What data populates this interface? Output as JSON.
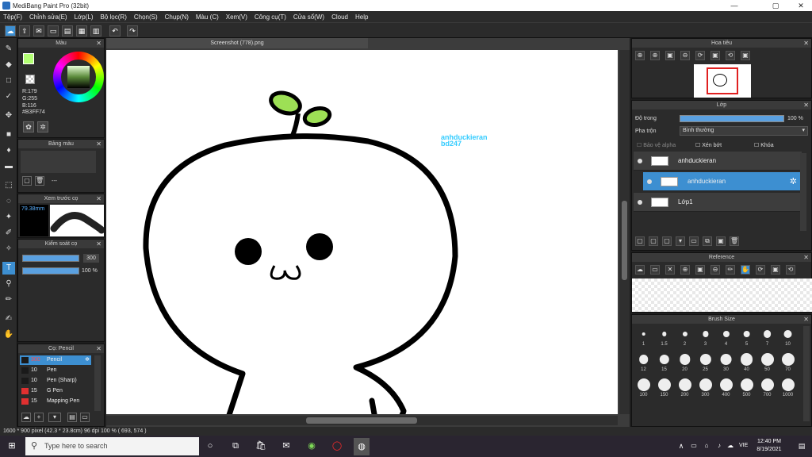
{
  "window": {
    "title": "MediBang Paint Pro (32bit)",
    "min": "—",
    "max": "▢",
    "close": "✕"
  },
  "menu": [
    "Tệp(F)",
    "Chỉnh sửa(E)",
    "Lớp(L)",
    "Bộ lọc(R)",
    "Chọn(S)",
    "Chụp(N)",
    "Màu (C)",
    "Xem(V)",
    "Công cụ(T)",
    "Cửa sổ(W)",
    "Cloud",
    "Help"
  ],
  "toolbar": {
    "undo": "↶",
    "redo": "↷"
  },
  "color_panel": {
    "title": "Màu",
    "rgb": "R:179\nG:255\nB:116",
    "hex": "#B3FF74"
  },
  "palette_panel": {
    "title": "Bảng màu",
    "dash": "---"
  },
  "brush_preview": {
    "title": "Xem trước cọ",
    "size": "79.38mm"
  },
  "brush_control": {
    "title": "Kiểm soát cọ",
    "size": "300",
    "opacity": "100 %",
    "size_level": 1.0,
    "opacity_level": 1.0
  },
  "brush_list": {
    "title": "Cọ: Pencil",
    "items": [
      {
        "size": "300",
        "name": "Pencil",
        "color": "#1a1a1a"
      },
      {
        "size": "10",
        "name": "Pen",
        "color": "#1a1a1a"
      },
      {
        "size": "10",
        "name": "Pen (Sharp)",
        "color": "#1a1a1a"
      },
      {
        "size": "15",
        "name": "G Pen",
        "color": "#e03030"
      },
      {
        "size": "15",
        "name": "Mapping Pen",
        "color": "#e03030"
      }
    ]
  },
  "document": {
    "tab": "Screenshot (778).png",
    "watermark1": "anhduckieran",
    "watermark2": "bd247"
  },
  "navigator": {
    "title": "Hoa tiêu"
  },
  "layer_panel": {
    "title": "Lớp",
    "opacity_label": "Độ trong",
    "opacity_value": "100 %",
    "opacity_level": 1.0,
    "blend_label": "Pha trộn",
    "blend_value": "Bình thường",
    "protect_alpha": "Bảo vệ alpha",
    "clipping": "Xén bớt",
    "lock": "Khóa",
    "layers": [
      {
        "name": "anhduckieran",
        "selected": false
      },
      {
        "name": "anhduckieran",
        "selected": true
      },
      {
        "name": "Lớp1",
        "selected": false
      }
    ]
  },
  "reference": {
    "title": "Reference"
  },
  "brush_size": {
    "title": "Brush Size",
    "sizes": [
      "1",
      "1.5",
      "2",
      "3",
      "4",
      "5",
      "7",
      "10",
      "12",
      "15",
      "20",
      "25",
      "30",
      "40",
      "50",
      "70",
      "100",
      "150",
      "200",
      "300",
      "400",
      "500",
      "700",
      "1000"
    ]
  },
  "status": "1600 * 900 pixel  (42.3 * 23.8cm)  96 dpi  100 %  ( 693, 574 )",
  "taskbar": {
    "search": "Type here to search",
    "time": "12:40 PM",
    "date": "8/19/2021",
    "lang": "VIE"
  }
}
